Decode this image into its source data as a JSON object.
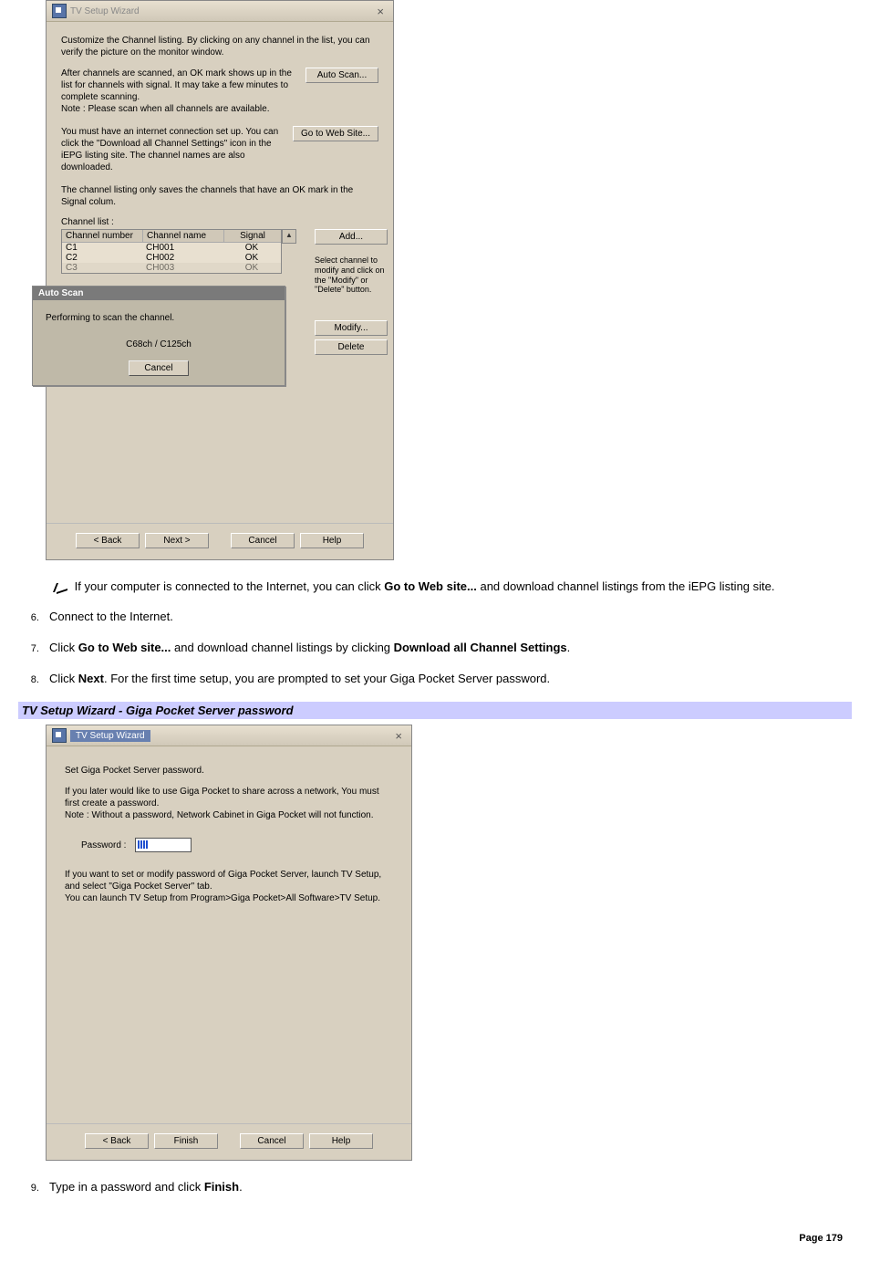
{
  "screenshot1": {
    "title": "TV Setup Wizard",
    "close": "×",
    "intro": "Customize the Channel listing. By clicking on any channel in the list, you can verify the picture on the monitor window.",
    "scanText": "After channels are scanned, an OK mark shows up in the list for channels with signal. It may take a few minutes to complete scanning.\nNote : Please scan when all channels are available.",
    "autoScanBtn": "Auto Scan...",
    "webText": "You must have an internet connection set up. You can click the \"Download all Channel Settings\" icon in the iEPG listing site. The channel names are also downloaded.",
    "webBtn": "Go to Web Site...",
    "saveText": "The channel listing only saves the channels that have an OK mark in the Signal colum.",
    "channelListLabel": "Channel list :",
    "headers": {
      "num": "Channel number",
      "name": "Channel name",
      "sig": "Signal"
    },
    "rows": [
      {
        "num": "C1",
        "name": "CH001",
        "sig": "OK"
      },
      {
        "num": "C2",
        "name": "CH002",
        "sig": "OK"
      },
      {
        "num": "C3",
        "name": "CH003",
        "sig": "OK"
      }
    ],
    "addBtn": "Add...",
    "selectText": "Select channel to modify and click on the \"Modify\" or \"Delete\" button.",
    "modifyBtn": "Modify...",
    "deleteBtn": "Delete",
    "autoScanDlg": {
      "title": "Auto Scan",
      "text": "Performing to scan the channel.",
      "progress": "C68ch / C125ch",
      "cancel": "Cancel"
    },
    "nav": {
      "back": "< Back",
      "next": "Next >",
      "cancel": "Cancel",
      "help": "Help"
    }
  },
  "body": {
    "note1_pre": "If your computer is connected to the Internet, you can click ",
    "note1_b": "Go to Web site...",
    "note1_post": " and download channel listings from the iEPG listing site.",
    "li6": "Connect to the Internet.",
    "li7_pre": "Click ",
    "li7_b1": "Go to Web site...",
    "li7_mid": " and download channel listings by clicking ",
    "li7_b2": "Download all Channel Settings",
    "li7_post": ".",
    "li8_pre": "Click ",
    "li8_b": "Next",
    "li8_post": ". For the first time setup, you are prompted to set your Giga Pocket Server password.",
    "heading2": "TV Setup Wizard - Giga Pocket Server password",
    "li9_pre": "Type in a password and click ",
    "li9_b": "Finish",
    "li9_post": "."
  },
  "screenshot2": {
    "title": "TV Setup Wizard",
    "close": "×",
    "line1": "Set Giga Pocket Server password.",
    "line2": "If you later would like to use Giga Pocket to share across a network, You must first create a password.\nNote : Without a password, Network Cabinet in Giga Pocket will not function.",
    "pwLabel": "Password :",
    "line3": "If you want to set or modify password of Giga Pocket Server, launch TV Setup, and select \"Giga Pocket Server\" tab.\nYou can launch TV Setup from Program>Giga Pocket>All Software>TV Setup.",
    "nav": {
      "back": "< Back",
      "finish": "Finish",
      "cancel": "Cancel",
      "help": "Help"
    }
  },
  "pageNumLabel": "Page 179"
}
